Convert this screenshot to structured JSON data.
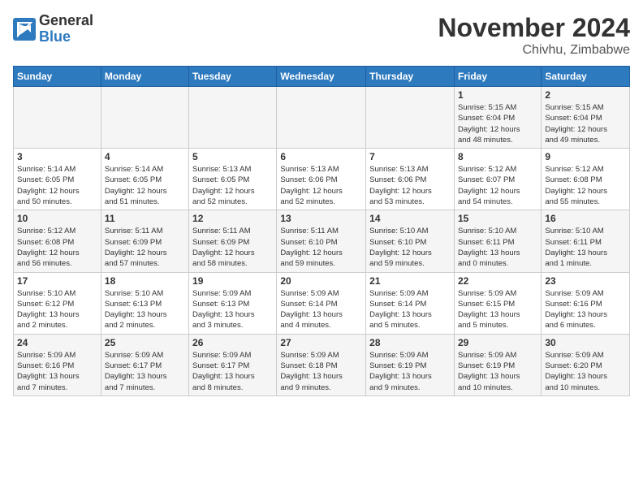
{
  "header": {
    "logo_general": "General",
    "logo_blue": "Blue",
    "title": "November 2024",
    "location": "Chivhu, Zimbabwe"
  },
  "days_of_week": [
    "Sunday",
    "Monday",
    "Tuesday",
    "Wednesday",
    "Thursday",
    "Friday",
    "Saturday"
  ],
  "weeks": [
    [
      {
        "day": "",
        "info": ""
      },
      {
        "day": "",
        "info": ""
      },
      {
        "day": "",
        "info": ""
      },
      {
        "day": "",
        "info": ""
      },
      {
        "day": "",
        "info": ""
      },
      {
        "day": "1",
        "info": "Sunrise: 5:15 AM\nSunset: 6:04 PM\nDaylight: 12 hours\nand 48 minutes."
      },
      {
        "day": "2",
        "info": "Sunrise: 5:15 AM\nSunset: 6:04 PM\nDaylight: 12 hours\nand 49 minutes."
      }
    ],
    [
      {
        "day": "3",
        "info": "Sunrise: 5:14 AM\nSunset: 6:05 PM\nDaylight: 12 hours\nand 50 minutes."
      },
      {
        "day": "4",
        "info": "Sunrise: 5:14 AM\nSunset: 6:05 PM\nDaylight: 12 hours\nand 51 minutes."
      },
      {
        "day": "5",
        "info": "Sunrise: 5:13 AM\nSunset: 6:05 PM\nDaylight: 12 hours\nand 52 minutes."
      },
      {
        "day": "6",
        "info": "Sunrise: 5:13 AM\nSunset: 6:06 PM\nDaylight: 12 hours\nand 52 minutes."
      },
      {
        "day": "7",
        "info": "Sunrise: 5:13 AM\nSunset: 6:06 PM\nDaylight: 12 hours\nand 53 minutes."
      },
      {
        "day": "8",
        "info": "Sunrise: 5:12 AM\nSunset: 6:07 PM\nDaylight: 12 hours\nand 54 minutes."
      },
      {
        "day": "9",
        "info": "Sunrise: 5:12 AM\nSunset: 6:08 PM\nDaylight: 12 hours\nand 55 minutes."
      }
    ],
    [
      {
        "day": "10",
        "info": "Sunrise: 5:12 AM\nSunset: 6:08 PM\nDaylight: 12 hours\nand 56 minutes."
      },
      {
        "day": "11",
        "info": "Sunrise: 5:11 AM\nSunset: 6:09 PM\nDaylight: 12 hours\nand 57 minutes."
      },
      {
        "day": "12",
        "info": "Sunrise: 5:11 AM\nSunset: 6:09 PM\nDaylight: 12 hours\nand 58 minutes."
      },
      {
        "day": "13",
        "info": "Sunrise: 5:11 AM\nSunset: 6:10 PM\nDaylight: 12 hours\nand 59 minutes."
      },
      {
        "day": "14",
        "info": "Sunrise: 5:10 AM\nSunset: 6:10 PM\nDaylight: 12 hours\nand 59 minutes."
      },
      {
        "day": "15",
        "info": "Sunrise: 5:10 AM\nSunset: 6:11 PM\nDaylight: 13 hours\nand 0 minutes."
      },
      {
        "day": "16",
        "info": "Sunrise: 5:10 AM\nSunset: 6:11 PM\nDaylight: 13 hours\nand 1 minute."
      }
    ],
    [
      {
        "day": "17",
        "info": "Sunrise: 5:10 AM\nSunset: 6:12 PM\nDaylight: 13 hours\nand 2 minutes."
      },
      {
        "day": "18",
        "info": "Sunrise: 5:10 AM\nSunset: 6:13 PM\nDaylight: 13 hours\nand 2 minutes."
      },
      {
        "day": "19",
        "info": "Sunrise: 5:09 AM\nSunset: 6:13 PM\nDaylight: 13 hours\nand 3 minutes."
      },
      {
        "day": "20",
        "info": "Sunrise: 5:09 AM\nSunset: 6:14 PM\nDaylight: 13 hours\nand 4 minutes."
      },
      {
        "day": "21",
        "info": "Sunrise: 5:09 AM\nSunset: 6:14 PM\nDaylight: 13 hours\nand 5 minutes."
      },
      {
        "day": "22",
        "info": "Sunrise: 5:09 AM\nSunset: 6:15 PM\nDaylight: 13 hours\nand 5 minutes."
      },
      {
        "day": "23",
        "info": "Sunrise: 5:09 AM\nSunset: 6:16 PM\nDaylight: 13 hours\nand 6 minutes."
      }
    ],
    [
      {
        "day": "24",
        "info": "Sunrise: 5:09 AM\nSunset: 6:16 PM\nDaylight: 13 hours\nand 7 minutes."
      },
      {
        "day": "25",
        "info": "Sunrise: 5:09 AM\nSunset: 6:17 PM\nDaylight: 13 hours\nand 7 minutes."
      },
      {
        "day": "26",
        "info": "Sunrise: 5:09 AM\nSunset: 6:17 PM\nDaylight: 13 hours\nand 8 minutes."
      },
      {
        "day": "27",
        "info": "Sunrise: 5:09 AM\nSunset: 6:18 PM\nDaylight: 13 hours\nand 9 minutes."
      },
      {
        "day": "28",
        "info": "Sunrise: 5:09 AM\nSunset: 6:19 PM\nDaylight: 13 hours\nand 9 minutes."
      },
      {
        "day": "29",
        "info": "Sunrise: 5:09 AM\nSunset: 6:19 PM\nDaylight: 13 hours\nand 10 minutes."
      },
      {
        "day": "30",
        "info": "Sunrise: 5:09 AM\nSunset: 6:20 PM\nDaylight: 13 hours\nand 10 minutes."
      }
    ]
  ]
}
